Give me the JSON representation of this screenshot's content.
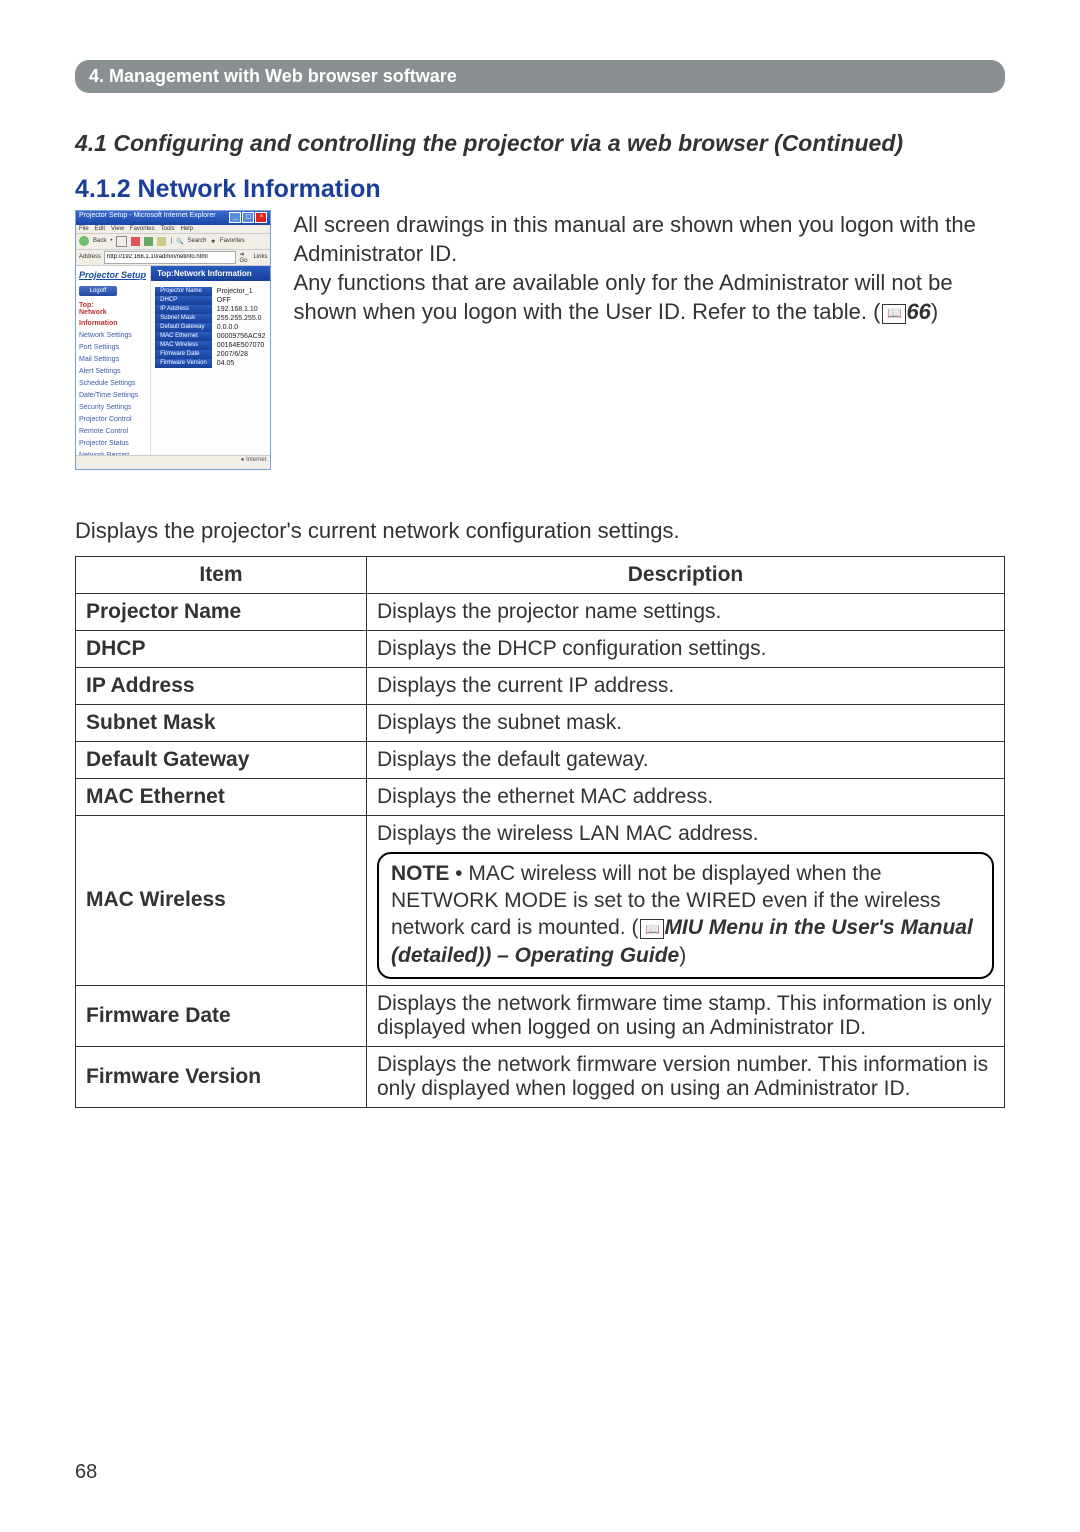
{
  "chapter_bar": "4. Management with Web browser software",
  "section_title": "4.1 Configuring and controlling the projector via a web browser (Continued)",
  "subsection_title": "4.1.2 Network Information",
  "intro_paragraph_1": "All screen drawings in this manual are shown when you logon with the Administrator ID.",
  "intro_paragraph_2a": "Any functions that are available only for the Administrator will not be shown when you logon with the User ID. Refer to the table. (",
  "intro_ref_page": "66",
  "intro_paragraph_2b": ")",
  "below_paragraph": "Displays the projector's current network configuration settings.",
  "table": {
    "header_item": "Item",
    "header_desc": "Description",
    "rows": [
      {
        "item": "Projector Name",
        "desc": "Displays the projector name settings."
      },
      {
        "item": "DHCP",
        "desc": "Displays the DHCP configuration settings."
      },
      {
        "item": "IP Address",
        "desc": "Displays the current IP address."
      },
      {
        "item": "Subnet Mask",
        "desc": "Displays the subnet mask."
      },
      {
        "item": "Default Gateway",
        "desc": "Displays the default gateway."
      },
      {
        "item": "MAC Ethernet",
        "desc": "Displays the ethernet MAC address."
      },
      {
        "item": "MAC Wireless",
        "desc_line": "Displays the wireless LAN MAC address.",
        "note_label": "NOTE",
        "note_text_a": "  • MAC wireless will not be displayed when the NETWORK MODE is set to the WIRED even if the wireless network card is mounted. (",
        "note_ref": "MIU Menu in the User's Manual (detailed)) – Operating Guide",
        "note_text_b": ")"
      },
      {
        "item": "Firmware Date",
        "desc": "Displays the network firmware time stamp. This information is only displayed when logged on using an Administrator ID."
      },
      {
        "item": "Firmware Version",
        "desc": "Displays the network firmware version number. This information is only displayed when logged on using an Administrator ID."
      }
    ]
  },
  "screenshot": {
    "window_title": "Projector Setup - Microsoft Internet Explorer",
    "menu": [
      "File",
      "Edit",
      "View",
      "Favorites",
      "Tools",
      "Help"
    ],
    "toolbar_back": "Back",
    "toolbar_search": "Search",
    "toolbar_fav": "Favorites",
    "address_label": "Address",
    "address_value": "http://192.168.1.10/admin/netinfo.html",
    "go_label": "Go",
    "links_label": "Links",
    "sidebar_title": "Projector Setup",
    "logoff": "Logoff",
    "side_top": "Top:",
    "side_top_sub1": "Network",
    "side_top_sub2": "Information",
    "side_items": [
      "Network Settings",
      "Port Settings",
      "Mail Settings",
      "Alert Settings",
      "Schedule Settings",
      "Date/Time Settings",
      "Security Settings",
      "Projector Control",
      "Remote Control",
      "Projector Status",
      "Network Restart"
    ],
    "main_title": "Top:Network Information",
    "kv": [
      {
        "k": "Projector Name",
        "v": "Projector_1"
      },
      {
        "k": "DHCP",
        "v": "OFF"
      },
      {
        "k": "IP Address",
        "v": "192.168.1.10"
      },
      {
        "k": "Subnet Mask",
        "v": "255.255.255.0"
      },
      {
        "k": "Default Gateway",
        "v": "0.0.0.0"
      },
      {
        "k": "MAC Ethernet",
        "v": "00009756AC92"
      },
      {
        "k": "MAC Wireless",
        "v": "00164E507070"
      },
      {
        "k": "Firmware Date",
        "v": "2007/6/28"
      },
      {
        "k": "Firmware Version",
        "v": "04.05"
      }
    ],
    "status_right": "Internet"
  },
  "page_number": "68"
}
